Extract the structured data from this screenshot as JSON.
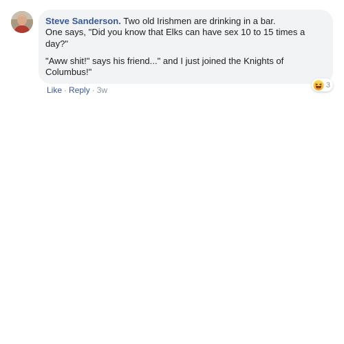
{
  "comment": {
    "author": "Steve Sanderson.",
    "text_line1": "Two old Irishmen are drinking in a bar.",
    "text_line2": "One says, \"Did you know that Elks can have sex 10 to 15 times a day?\"",
    "text_para2": "\"Aww shit!\" says his friend...\" and I just joined the Knights of Columbus!\"",
    "avatar_icon": "profile-photo",
    "reaction": {
      "icon": "haha-emoji-icon",
      "count": "3"
    },
    "actions": {
      "like_label": "Like",
      "reply_label": "Reply",
      "separator": "·",
      "timestamp": "3w"
    }
  },
  "colors": {
    "bubble_bg": "#f2f3f5",
    "author_link": "#385898",
    "meta_text": "#8d949e",
    "reaction_yellow": "#f7b125"
  }
}
